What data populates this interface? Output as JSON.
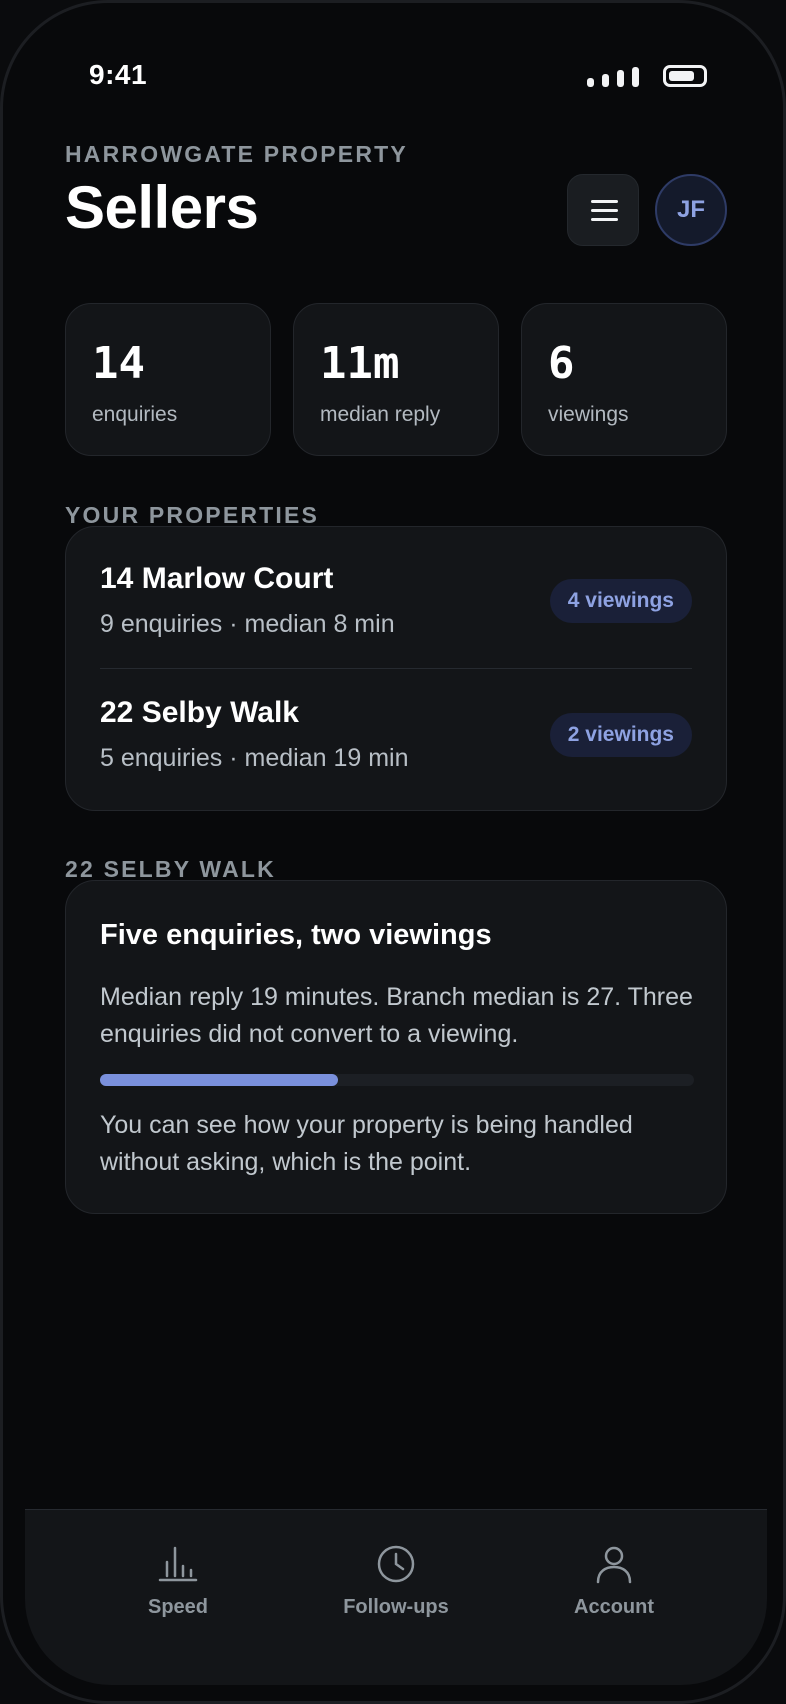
{
  "status_bar": {
    "time": "9:41"
  },
  "header": {
    "eyebrow": "HARROWGATE PROPERTY",
    "title": "Sellers",
    "avatar_initials": "JF"
  },
  "stats": [
    {
      "value": "14",
      "label": "enquiries"
    },
    {
      "value": "11m",
      "label": "median reply"
    },
    {
      "value": "6",
      "label": "viewings"
    }
  ],
  "properties": {
    "section_label": "YOUR PROPERTIES",
    "items": [
      {
        "name": "14 Marlow Court",
        "meta": "9 enquiries · median 8 min",
        "badge": "4 viewings"
      },
      {
        "name": "22 Selby Walk",
        "meta": "5 enquiries · median 19 min",
        "badge": "2 viewings"
      }
    ]
  },
  "insight": {
    "section_label": "22 SELBY WALK",
    "title": "Five enquiries, two viewings",
    "body": "Median reply 19 minutes. Branch median is 27. Three enquiries did not convert to a viewing.",
    "progress_fraction": 0.4,
    "note": "You can see how your property is being handled without asking, which is the point."
  },
  "tabs": [
    {
      "label": "Speed",
      "icon": "bar-chart-icon"
    },
    {
      "label": "Follow-ups",
      "icon": "clock-icon"
    },
    {
      "label": "Account",
      "icon": "person-icon"
    }
  ],
  "colors": {
    "background": "#08090b",
    "card": "#131518",
    "accent": "#7a90dc",
    "badge_bg": "#1a2038",
    "muted_text": "#8e969d"
  }
}
